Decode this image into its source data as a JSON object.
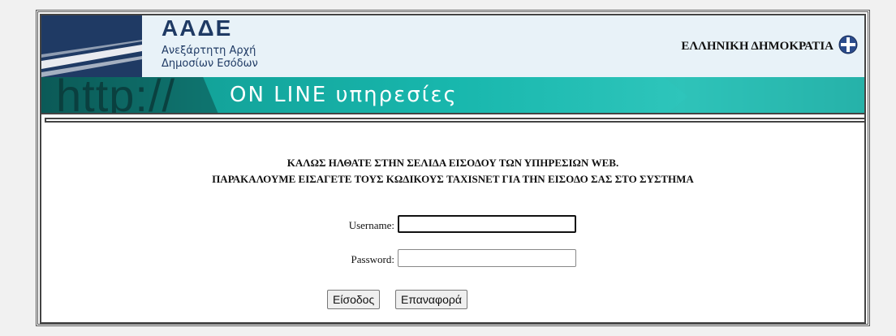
{
  "header": {
    "org_acronym": "ΑΑΔΕ",
    "org_line1": "Ανεξάρτητη Αρχή",
    "org_line2": "Δημοσίων Εσόδων",
    "republic": "ΕΛΛΗΝΙΚΗ ΔΗΜΟΚΡΑΤΙΑ",
    "banner_http": "http://",
    "banner_online": "ON LINE υπηρεσίες"
  },
  "main": {
    "welcome_line1": "ΚΑΛΩΣ ΗΛΘΑΤΕ ΣΤΗΝ ΣΕΛΙΔΑ ΕΙΣΟΔΟΥ ΤΩΝ ΥΠΗΡΕΣΙΩΝ WEB.",
    "welcome_line2": "ΠΑΡΑΚΑΛΟΥΜΕ ΕΙΣΑΓΕΤΕ ΤΟΥΣ ΚΩΔΙΚΟΥΣ TAXISNET ΓΙΑ ΤΗΝ ΕΙΣΟΔΟ ΣΑΣ ΣΤΟ ΣΥΣΤΗΜΑ"
  },
  "form": {
    "username_label": "Username:",
    "username_value": "",
    "password_label": "Password:",
    "password_value": "",
    "login_button": "Είσοδος",
    "reset_button": "Επαναφορά"
  },
  "colors": {
    "brand_navy": "#1f3a64",
    "banner_teal": "#18b7ad"
  }
}
